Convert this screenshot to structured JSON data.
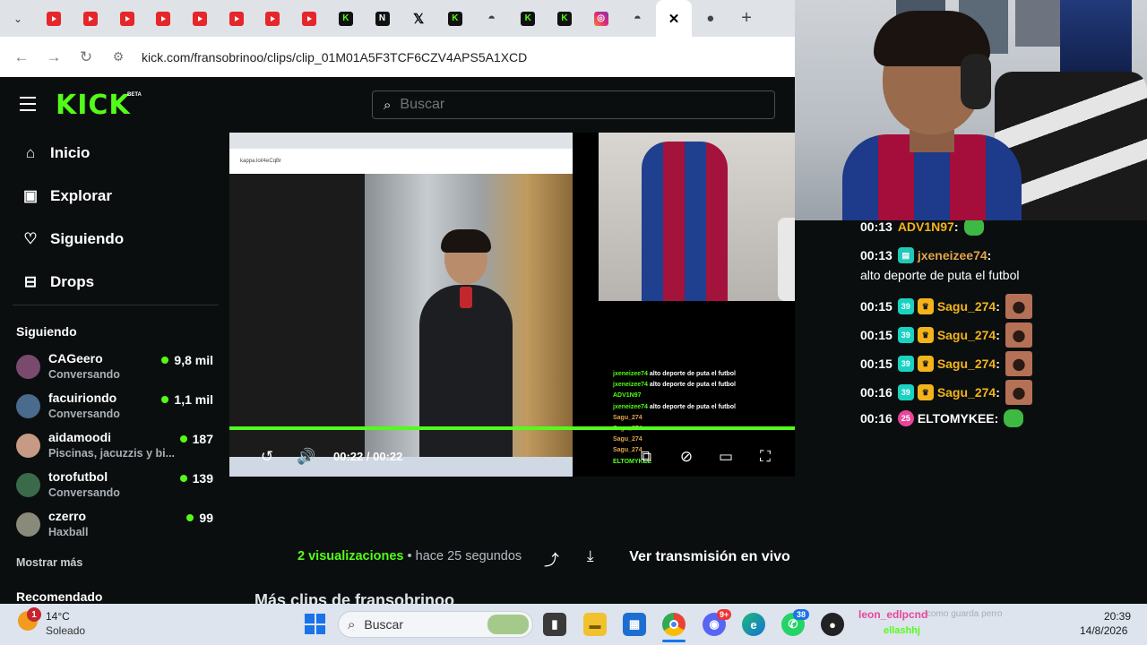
{
  "browser": {
    "tab_icons": [
      "youtube-icon",
      "youtube-icon",
      "youtube-icon",
      "youtube-icon",
      "youtube-icon",
      "youtube-icon",
      "youtube-icon",
      "youtube-icon",
      "kick-icon",
      "nb-icon",
      "x-icon",
      "kick-icon",
      "github-icon",
      "kick-icon",
      "kick-icon",
      "instagram-icon",
      "github-icon",
      "close-icon",
      "frog-icon"
    ],
    "url": "kick.com/fransobrinoo/clips/clip_01M01A5F3TCF6CZV4APS5A1XCD"
  },
  "site": {
    "logo": "KICK",
    "logo_badge": "BETA",
    "search_placeholder": "Buscar",
    "menu": [
      {
        "label": "Inicio",
        "icon": "home-icon"
      },
      {
        "label": "Explorar",
        "icon": "explore-icon"
      },
      {
        "label": "Siguiendo",
        "icon": "heart-icon"
      },
      {
        "label": "Drops",
        "icon": "drops-icon"
      }
    ],
    "following_title": "Siguiendo",
    "following": [
      {
        "name": "CAGeero",
        "sub": "Conversando",
        "count": "9,8 mil",
        "color": "#7a4a6e"
      },
      {
        "name": "facuiriondo",
        "sub": "Conversando",
        "count": "1,1 mil",
        "color": "#4a6a8e"
      },
      {
        "name": "aidamoodi",
        "sub": "Piscinas, jacuzzis y bi...",
        "count": "187",
        "color": "#c69a84"
      },
      {
        "name": "torofutbol",
        "sub": "Conversando",
        "count": "139",
        "color": "#3a6a4a"
      },
      {
        "name": "czerro",
        "sub": "Haxball",
        "count": "99",
        "color": "#8a8a7a"
      }
    ],
    "show_more": "Mostrar más",
    "recommended": "Recomendado"
  },
  "player": {
    "inner_url": "kappa.lol/4eCqBr",
    "time_current": "00:22",
    "time_separator": "/",
    "time_total": "00:22",
    "progress": 1.0,
    "mini_chat": [
      {
        "user": "jxeneizee74",
        "text": "alto deporte de puta el futbol"
      },
      {
        "user": "jxeneizee74",
        "text": "alto deporte de puta el futbol"
      },
      {
        "user": "ADV1N97",
        "text": ""
      },
      {
        "user": "jxeneizee74",
        "text": "alto deporte de puta el futbol"
      },
      {
        "user": "Sagu_274",
        "text": ""
      },
      {
        "user": "Sagu_274",
        "text": ""
      },
      {
        "user": "Sagu_274",
        "text": ""
      },
      {
        "user": "Sagu_274",
        "text": ""
      },
      {
        "user": "ELTOMYKEE",
        "text": ""
      }
    ]
  },
  "clip_info": {
    "views_count": "2",
    "views_label": "visualizaciones",
    "separator": "•",
    "time_ago": "hace 25 segundos",
    "live_button": "Ver transmisión en vivo",
    "more_clips": "Más clips de fransobrinoo"
  },
  "chat": [
    {
      "time": "00:13",
      "user": "ADV1N97",
      "user_color": "#f3b41b",
      "badges": [],
      "text": "",
      "emote": "green"
    },
    {
      "time": "00:13",
      "user": "jxeneizee74",
      "user_color": "#e0a44a",
      "badges": [
        "kick"
      ],
      "text": "alto deporte de puta el futbol",
      "emote": ""
    },
    {
      "time": "00:15",
      "user": "Sagu_274",
      "user_color": "#f3b41b",
      "badges": [
        "39",
        "crown"
      ],
      "text": "",
      "emote": "face"
    },
    {
      "time": "00:15",
      "user": "Sagu_274",
      "user_color": "#f3b41b",
      "badges": [
        "39",
        "crown"
      ],
      "text": "",
      "emote": "face"
    },
    {
      "time": "00:15",
      "user": "Sagu_274",
      "user_color": "#f3b41b",
      "badges": [
        "39",
        "crown"
      ],
      "text": "",
      "emote": "face"
    },
    {
      "time": "00:16",
      "user": "Sagu_274",
      "user_color": "#f3b41b",
      "badges": [
        "39",
        "crown"
      ],
      "text": "",
      "emote": "face"
    },
    {
      "time": "00:16",
      "user": "ELTOMYKEE",
      "user_color": "#ffffff",
      "badges": [
        "25"
      ],
      "text": "",
      "emote": "green"
    }
  ],
  "taskbar": {
    "weather_badge": "1",
    "temp": "14°C",
    "weather": "Soleado",
    "search": "Buscar",
    "discord_badge": "9+",
    "whatsapp_badge": "38",
    "notif_user": "leon_edlpcnd",
    "notif_text": "como guarda perro",
    "notif_user2": "ellashhj",
    "time": "20:39",
    "date": "14/8/2026"
  }
}
